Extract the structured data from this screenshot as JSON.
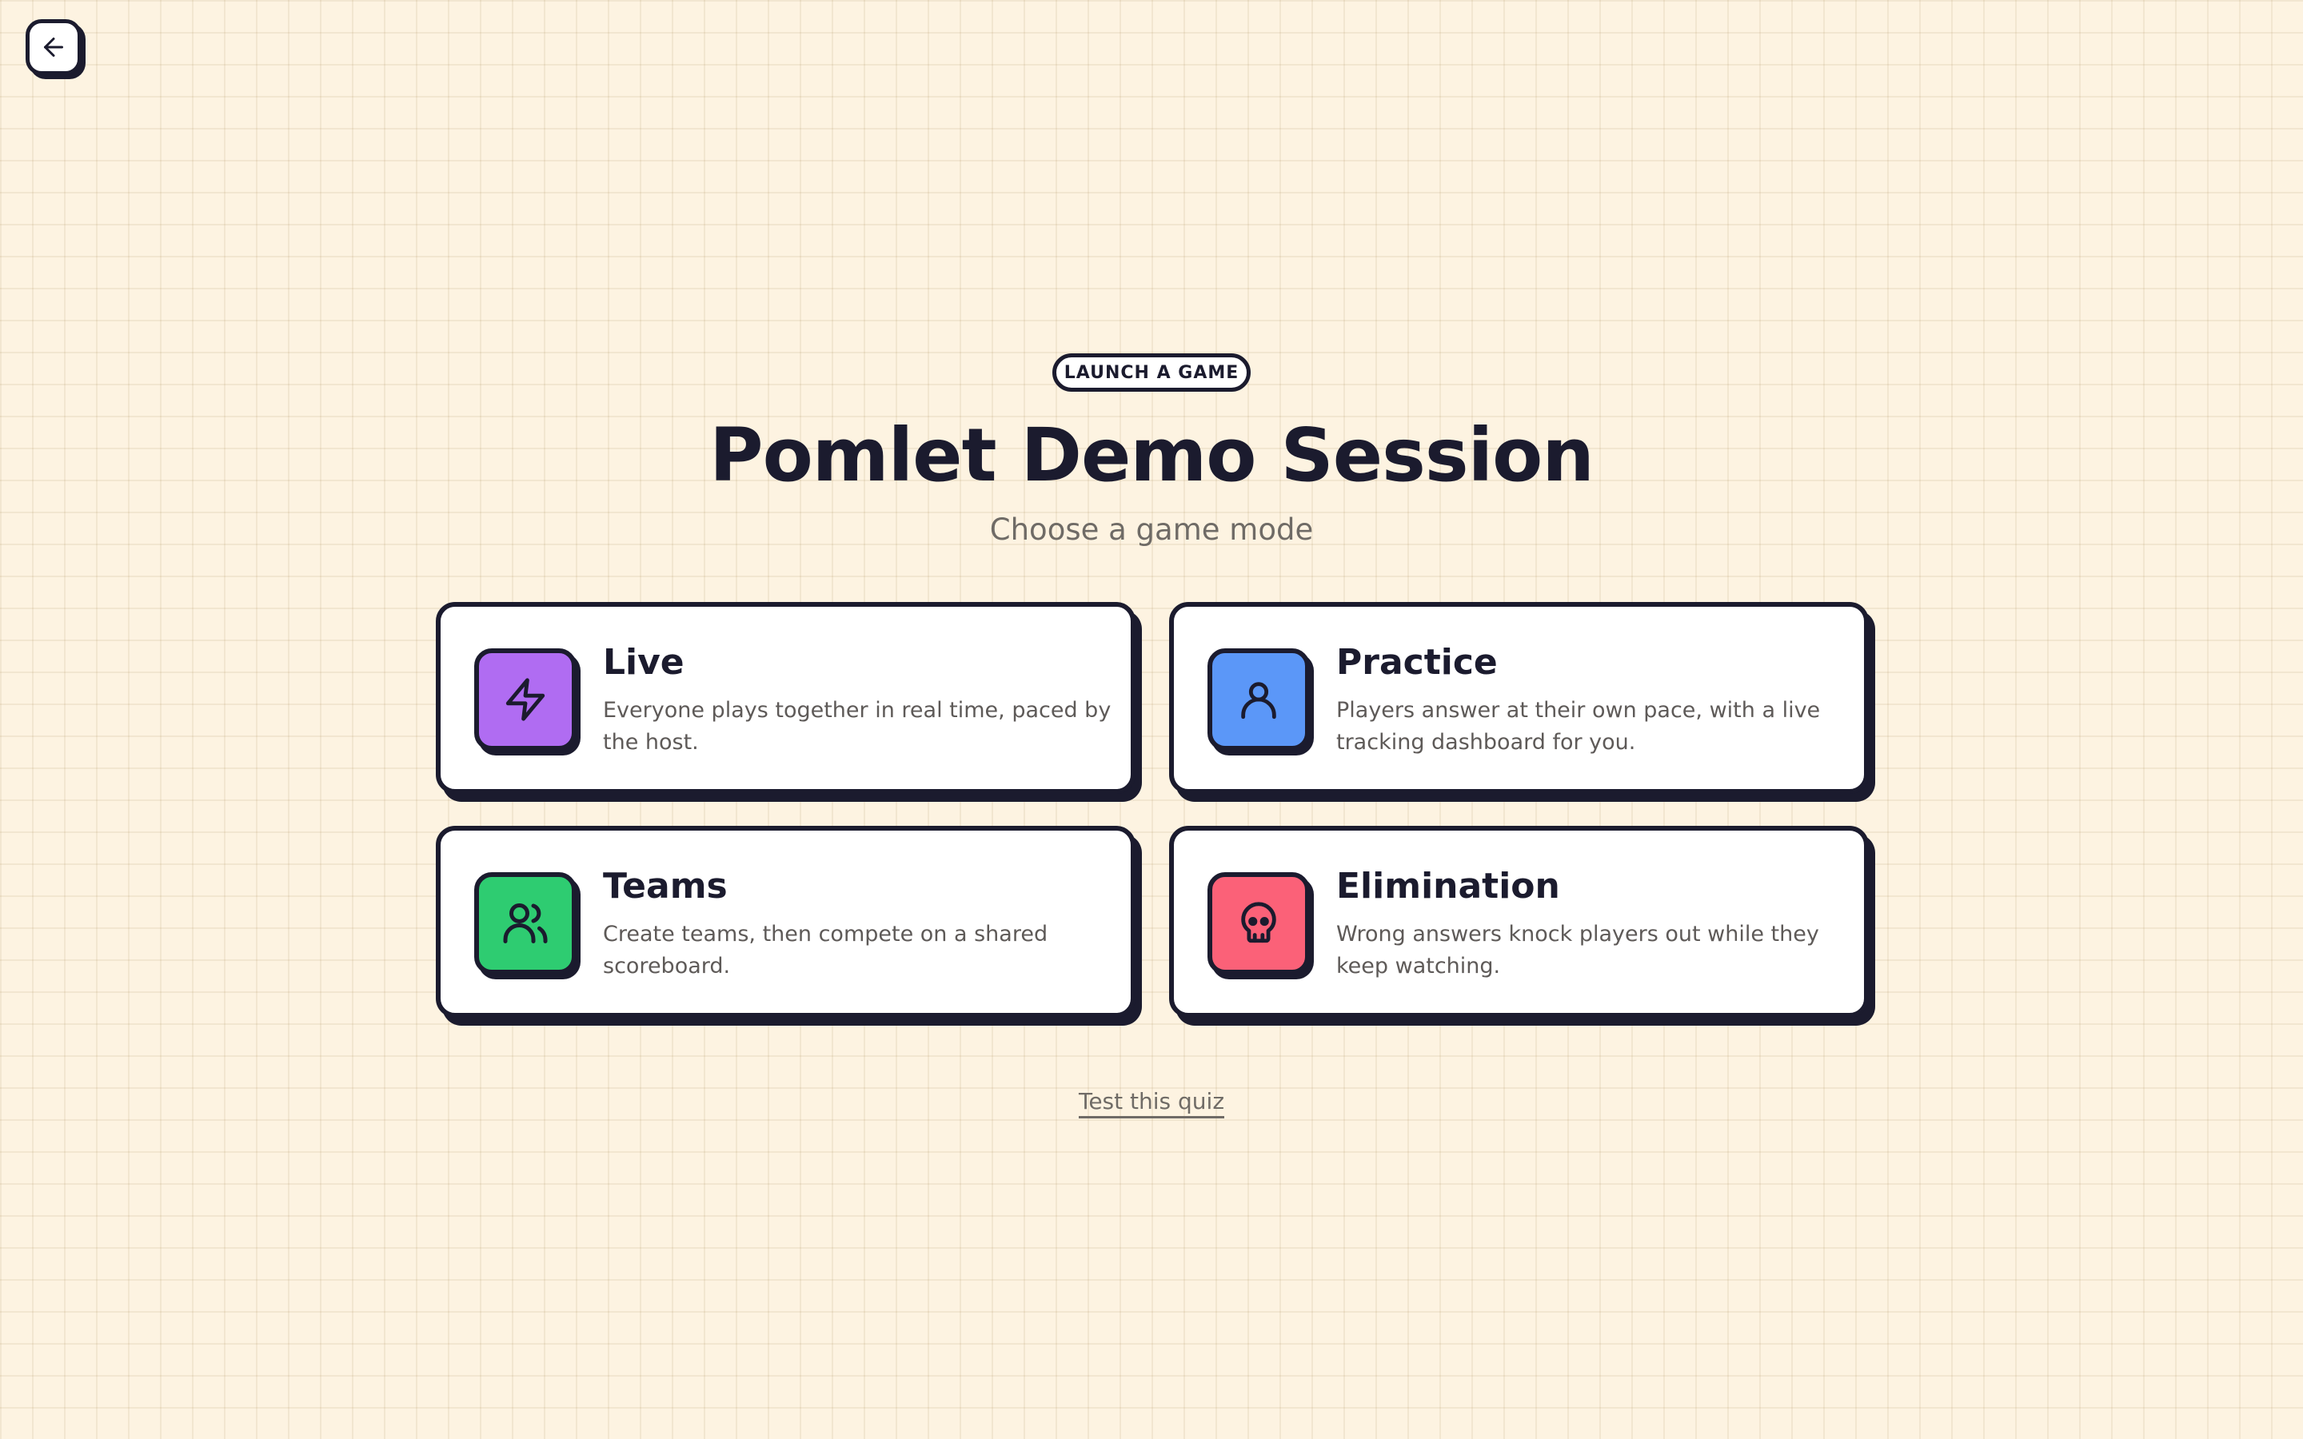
{
  "nav": {
    "back_icon": "arrow-left-icon"
  },
  "header": {
    "eyebrow": "LAUNCH A GAME",
    "title": "Pomlet Demo Session",
    "subtitle": "Choose a game mode"
  },
  "modes": [
    {
      "title": "Live",
      "description": "Everyone plays together in real time, paced by the host.",
      "icon": "lightning-bolt-icon",
      "color": "#b06cf2"
    },
    {
      "title": "Practice",
      "description": "Players answer at their own pace, with a live tracking dashboard for you.",
      "icon": "user-icon",
      "color": "#5b97f8"
    },
    {
      "title": "Teams",
      "description": "Create teams, then compete on a shared scoreboard.",
      "icon": "users-icon",
      "color": "#2ecc71"
    },
    {
      "title": "Elimination",
      "description": "Wrong answers knock players out while they keep watching.",
      "icon": "skull-icon",
      "color": "#fb6178"
    }
  ],
  "footer": {
    "test_link": "Test this quiz"
  },
  "colors": {
    "background": "#fdf3e1",
    "ink": "#1b1b2e",
    "card": "#ffffff",
    "muted_text": "#6f6b66"
  }
}
